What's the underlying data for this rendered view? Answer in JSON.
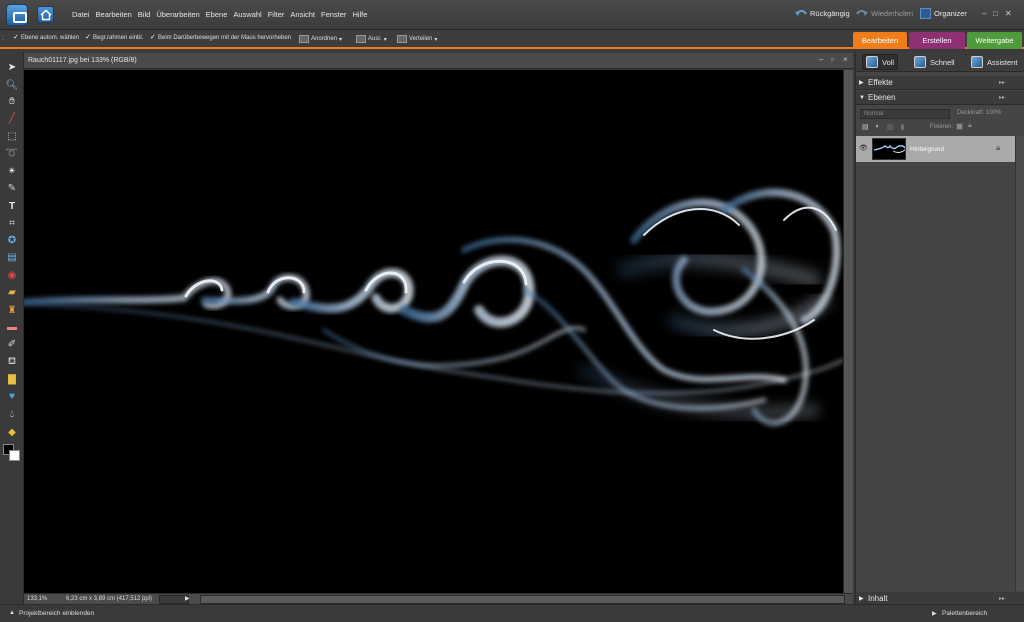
{
  "menubar": {
    "items": [
      "Datei",
      "Bearbeiten",
      "Bild",
      "Überarbeiten",
      "Ebene",
      "Auswahl",
      "Filter",
      "Ansicht",
      "Fenster",
      "Hilfe"
    ],
    "undo_label": "Rückgängig",
    "redo_label": "Wiederholen",
    "organizer_label": "Organizer",
    "window_controls": [
      "–",
      "□",
      "✕"
    ]
  },
  "options": {
    "auto_select": "Ebene autom. wählen",
    "bounding_box": "Begr.rahmen einbl.",
    "highlight": "Beim Darüberbewegen mit der Maus hervorheben",
    "arrange": "Anordnen",
    "align": "Ausr.",
    "distribute": "Verteilen"
  },
  "mode_tabs": [
    {
      "label": "Bearbeiten",
      "color": "#ef7d1a"
    },
    {
      "label": "Erstellen",
      "color": "#8f2f74"
    },
    {
      "label": "Weitergabe",
      "color": "#4f9a3b"
    }
  ],
  "document": {
    "title": "Rauch01117.jpg bei 133% (RGB/8)",
    "zoom": "133,1%",
    "size_info": "6,23 cm x 3,89 cm (417,512 ppi)"
  },
  "panel": {
    "tabs": [
      "Voll",
      "Schnell",
      "Assistent"
    ],
    "effects_label": "Effekte",
    "layers_label": "Ebenen",
    "blend_mode": "Normal",
    "opacity_label": "Deckkraft:",
    "opacity_value": "100%",
    "lock_label": "Fixieren:",
    "layer_name": "Hintergrund",
    "content_label": "Inhalt"
  },
  "bottombar": {
    "project_bin": "Projektbereich einblenden",
    "palette_bin": "Palettenbereich"
  },
  "colors": {
    "accent": "#ef7d1a",
    "smoke": "#9ec4ea"
  }
}
